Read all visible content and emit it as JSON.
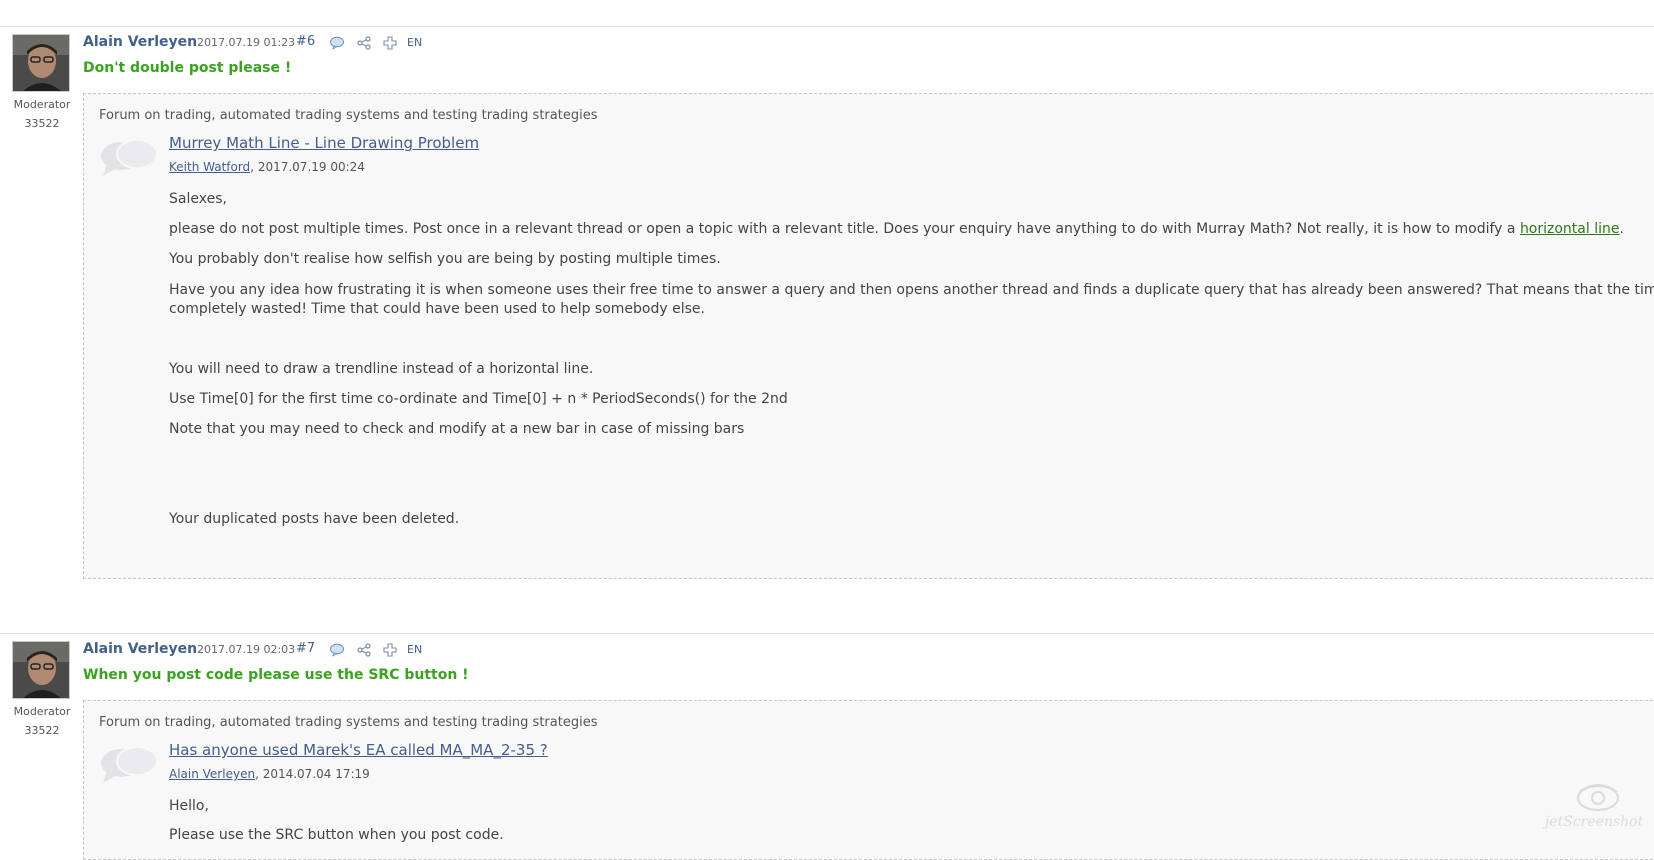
{
  "posts": [
    {
      "author": "Alain Verleyen",
      "date": "2017.07.19 01:23",
      "number": "#6",
      "lang": "EN",
      "role": "Moderator",
      "rating": "33522",
      "headline": "Don't double post please !",
      "quote": {
        "forum": "Forum on trading, automated trading systems and testing trading strategies",
        "topic": "Murrey Math Line - Line Drawing Problem",
        "quote_author": "Keith Watford",
        "quote_date": ", 2017.07.19 00:24",
        "p1": "Salexes,",
        "p2": "please do not post multiple times. Post once in a relevant thread or open a topic with a relevant title. Does your enquiry have anything to do with Murray Math? Not really, it is how to modify a ",
        "p2_link": "horizontal line",
        "p2_end": ".",
        "p3": "You probably don't realise how selfish you are being by posting multiple times.",
        "p4a": "Have you any idea how frustrating it is when someone uses their free time to answer a query and then opens another thread and finds a duplicate query that has already been answered? That means that the time spent is",
        "p4b": "completely wasted! Time that could have been used to help somebody else.",
        "p5": "You will need to draw a trendline instead of a horizontal line.",
        "p6": "Use Time[0] for the first time co-ordinate and Time[0] + n * PeriodSeconds() for the 2nd",
        "p7": "Note that you may need to check and modify at a new bar in case of missing bars",
        "p8": "Your duplicated posts have been deleted."
      }
    },
    {
      "author": "Alain Verleyen",
      "date": "2017.07.19 02:03",
      "number": "#7",
      "lang": "EN",
      "role": "Moderator",
      "rating": "33522",
      "headline": "When you post code please use the SRC button !",
      "quote": {
        "forum": "Forum on trading, automated trading systems and testing trading strategies",
        "topic": "Has anyone used Marek's EA called MA_MA_2-35 ?",
        "quote_author": "Alain Verleyen",
        "quote_date": ", 2014.07.04 17:19",
        "p1": "Hello,",
        "p2_partial": "Please use the SRC button when you post code."
      }
    }
  ],
  "icons": [
    "comment-icon",
    "share-icon",
    "plus-icon",
    "speech-bubble-icon"
  ],
  "watermark": "jetScreenshot",
  "colors": {
    "link": "#42608a",
    "headline": "#39a320",
    "quote_bg": "#f8f8f9"
  }
}
